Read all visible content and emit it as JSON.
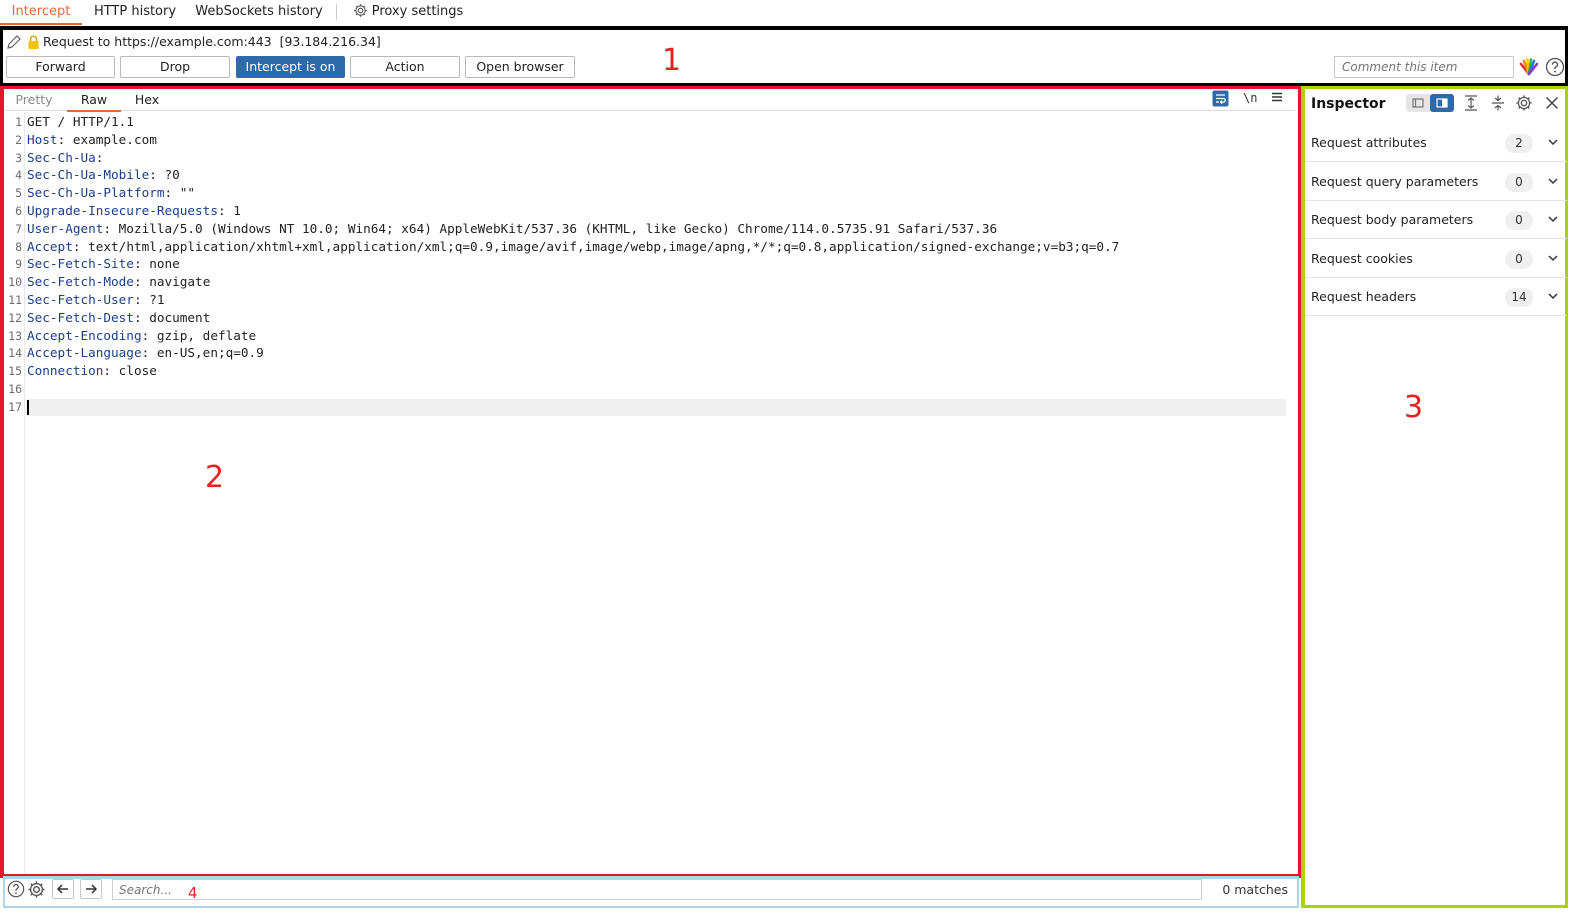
{
  "tabs": [
    {
      "label": "Intercept"
    },
    {
      "label": "HTTP history"
    },
    {
      "label": "WebSockets history"
    },
    {
      "label": "Proxy settings",
      "icon": "gear-icon"
    }
  ],
  "request": {
    "line": "Request to https://example.com:443",
    "ip": "[93.184.216.34]"
  },
  "toolbar": {
    "forward": "Forward",
    "drop": "Drop",
    "intercept": "Intercept is on",
    "action": "Action",
    "open_browser": "Open browser",
    "comment_placeholder": "Comment this item"
  },
  "editor": {
    "tabs": [
      "Pretty",
      "Raw",
      "Hex"
    ],
    "active_tab": "Raw",
    "newline_toggle": "\\n",
    "lines": [
      {
        "num": "1",
        "key": "",
        "rest": "GET / HTTP/1.1"
      },
      {
        "num": "2",
        "key": "Host",
        "rest": ": example.com"
      },
      {
        "num": "3",
        "key": "Sec-Ch-Ua",
        "rest": ":"
      },
      {
        "num": "4",
        "key": "Sec-Ch-Ua-Mobile",
        "rest": ": ?0"
      },
      {
        "num": "5",
        "key": "Sec-Ch-Ua-Platform",
        "rest": ": \"\""
      },
      {
        "num": "6",
        "key": "Upgrade-Insecure-Requests",
        "rest": ": 1"
      },
      {
        "num": "7",
        "key": "User-Agent",
        "rest": ": Mozilla/5.0 (Windows NT 10.0; Win64; x64) AppleWebKit/537.36 (KHTML, like Gecko) Chrome/114.0.5735.91 Safari/537.36"
      },
      {
        "num": "8",
        "key": "Accept",
        "rest": ": text/html,application/xhtml+xml,application/xml;q=0.9,image/avif,image/webp,image/apng,*/*;q=0.8,application/signed-exchange;v=b3;q=0.7"
      },
      {
        "num": "9",
        "key": "Sec-Fetch-Site",
        "rest": ": none"
      },
      {
        "num": "10",
        "key": "Sec-Fetch-Mode",
        "rest": ": navigate"
      },
      {
        "num": "11",
        "key": "Sec-Fetch-User",
        "rest": ": ?1"
      },
      {
        "num": "12",
        "key": "Sec-Fetch-Dest",
        "rest": ": document"
      },
      {
        "num": "13",
        "key": "Accept-Encoding",
        "rest": ": gzip, deflate"
      },
      {
        "num": "14",
        "key": "Accept-Language",
        "rest": ": en-US,en;q=0.9"
      },
      {
        "num": "15",
        "key": "Connection",
        "rest": ": close"
      },
      {
        "num": "16",
        "key": "",
        "rest": ""
      },
      {
        "num": "17",
        "key": "",
        "rest": ""
      }
    ]
  },
  "search": {
    "placeholder": "Search...",
    "matches": "0 matches"
  },
  "inspector": {
    "title": "Inspector",
    "rows": [
      {
        "label": "Request attributes",
        "count": "2"
      },
      {
        "label": "Request query parameters",
        "count": "0"
      },
      {
        "label": "Request body parameters",
        "count": "0"
      },
      {
        "label": "Request cookies",
        "count": "0"
      },
      {
        "label": "Request headers",
        "count": "14"
      }
    ]
  },
  "annotations": [
    "1",
    "2",
    "3",
    "4"
  ],
  "colors": {
    "accent_orange": "#e8683a",
    "primary_blue": "#2f6aa8",
    "header_key": "#1b3f8c",
    "section1_border": "#000000",
    "section2_border": "#e5162b",
    "section3_border": "#aad400",
    "section4_border": "#a9d8ea",
    "annotation_red": "#e52222"
  }
}
